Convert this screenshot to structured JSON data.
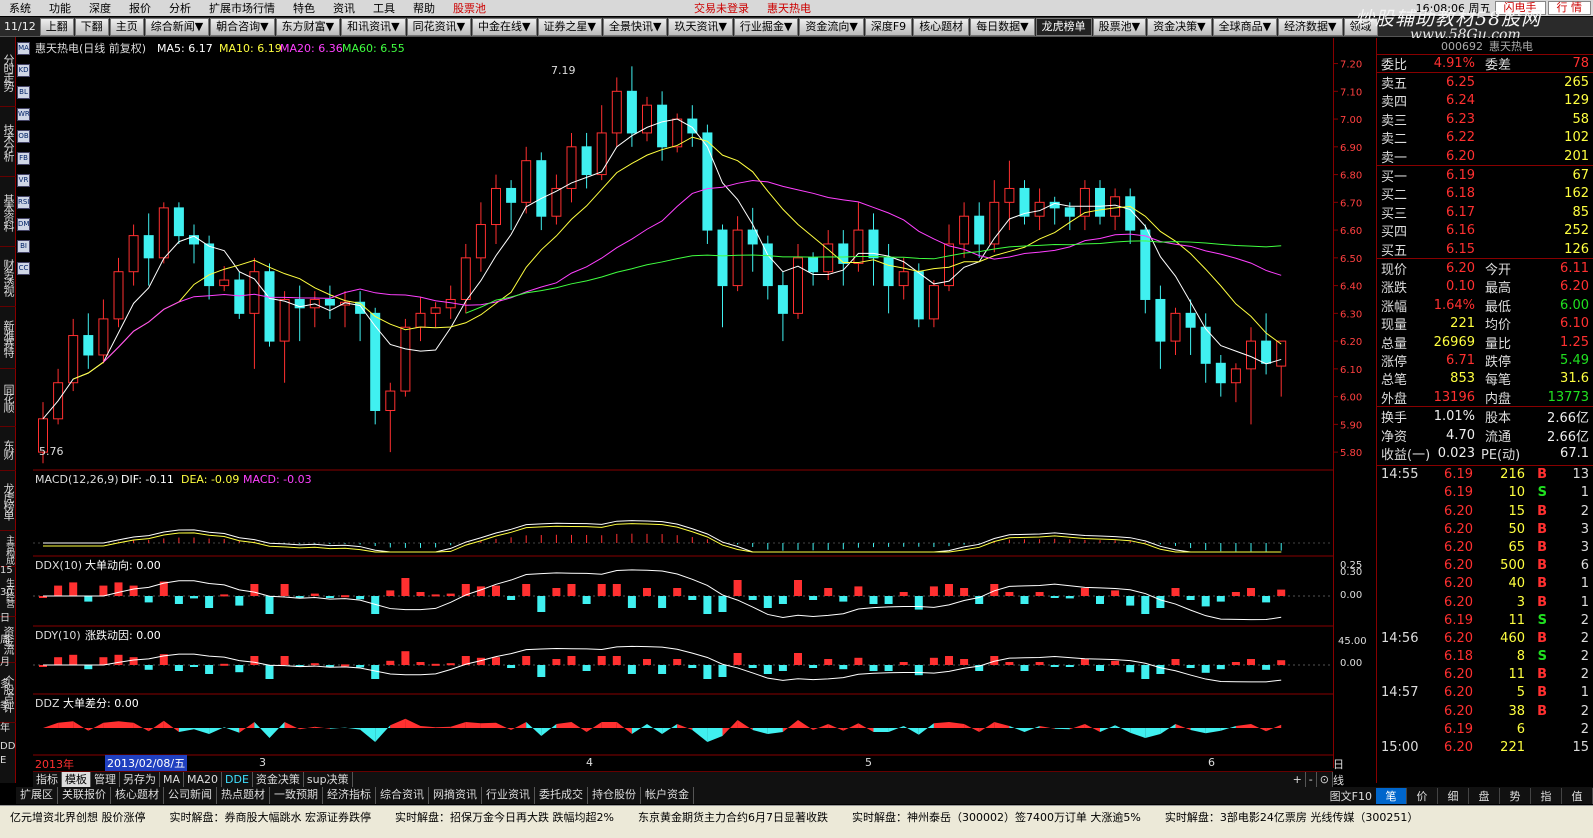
{
  "menubar": {
    "items": [
      "系统",
      "功能",
      "深度",
      "报价",
      "分析",
      "扩展市场行情",
      "特色",
      "资讯",
      "工具",
      "帮助"
    ],
    "stock_pool": "股票池",
    "login_status": "交易未登录",
    "stock_title": "惠天热电",
    "clock": "16:08:06 周五",
    "flash_button": "闪电手",
    "quote_button": "行 情"
  },
  "toolbar": {
    "page": "11/12",
    "buttons": [
      "上翻",
      "下翻",
      "主页",
      "综合新闻▼",
      "朝合咨询▼",
      "东方财富▼",
      "和讯资讯▼",
      "同花资讯▼",
      "中金在线▼",
      "证券之星▼",
      "全景快讯▼",
      "玖天资讯▼",
      "行业掘金▼",
      "资金流向▼",
      "深度F9",
      "核心题材",
      "每日数据▼",
      "龙虎榜单",
      "股票池▼",
      "资金决策▼",
      "全球商品▼",
      "经济数据▼",
      "领域"
    ]
  },
  "watermark": {
    "line1": "炒股辅助教材58股网",
    "line2": "www.58Gu.com"
  },
  "left_tabs": [
    "分时走势",
    "技术分析",
    "基本资料",
    "财务透视",
    "新雅赛特",
    "同花顺",
    "东财",
    "龙虎榜单",
    "主营构成",
    "生产经营",
    "资金流",
    "个股点评"
  ],
  "left_side_labels": [
    "15",
    "30",
    "日",
    "周",
    "月",
    "多",
    "季",
    "年",
    "DD",
    "E"
  ],
  "icons": [
    "ma-icon",
    "kdj-icon",
    "boll-icon",
    "wr-icon",
    "obv-icon",
    "fib-icon",
    "vr-icon",
    "rsi-icon",
    "dmi-icon",
    "bias-icon",
    "cci-icon"
  ],
  "icon_labels": [
    "MA",
    "KD",
    "BL",
    "WR",
    "OB",
    "FB",
    "VR",
    "RSI",
    "DM",
    "BI",
    "CC"
  ],
  "main_chart": {
    "title": "惠天热电(日线 前复权)",
    "ma5_label": "MA5: 6.17",
    "ma10_label": "MA10: 6.19",
    "ma20_label": "MA20: 6.36",
    "ma60_label": "MA60: 6.55",
    "high_marker": "7.19",
    "low_marker": "5.76",
    "price_scale": [
      "7.20",
      "7.10",
      "7.00",
      "6.90",
      "6.80",
      "6.70",
      "6.60",
      "6.50",
      "6.40",
      "6.30",
      "6.20",
      "6.10",
      "6.00",
      "5.90",
      "5.80"
    ],
    "colors": {
      "up": "#ff3030",
      "down": "#40f0f0",
      "ma5": "#ffffff",
      "ma10": "#ffff40",
      "ma20": "#ff40ff",
      "ma60": "#40ff40"
    }
  },
  "macd": {
    "title": "MACD(12,26,9)",
    "dif": "DIF: -0.11",
    "dea": "DEA: -0.09",
    "macd": "MACD: -0.03",
    "scale": [
      "0.25"
    ]
  },
  "ddx": {
    "title": "DDX(10)",
    "name": "大单动向: 0.00",
    "scale": [
      "0.30",
      "0.00"
    ]
  },
  "ddy": {
    "title": "DDY(10)",
    "name": "涨跌动因: 0.00",
    "scale": [
      "45.00",
      "0.00"
    ]
  },
  "ddz": {
    "title": "DDZ",
    "name": "大单差分: 0.00"
  },
  "datebar": {
    "year": "2013年",
    "cursor_date": "2013/02/08/五",
    "months": [
      "3",
      "4",
      "5",
      "6"
    ],
    "period": "日线"
  },
  "bottom_tabs1": [
    "指标",
    "模板",
    "管理",
    "另存为",
    "MA",
    "MA20",
    "DDE",
    "资金决策",
    "sup决策"
  ],
  "bottom_tabs2": [
    "扩展区",
    "关联报价",
    "核心题材",
    "公司新闻",
    "热点题材",
    "一致预期",
    "经济指标",
    "综合资讯",
    "网摘资讯",
    "行业资讯",
    "委托成交",
    "持仓股份",
    "帐户资金"
  ],
  "bottom_tabs2_right": "图文F10",
  "zoom_buttons": [
    "+",
    "-",
    "⊙"
  ],
  "right_tabs": [
    "笔",
    "价",
    "细",
    "盘",
    "势",
    "指",
    "值"
  ],
  "quote": {
    "code": "000692",
    "name": "惠天热电",
    "webi": {
      "label": "委比",
      "value": "4.91%",
      "label2": "委差",
      "value2": "78"
    },
    "sell": [
      {
        "label": "卖五",
        "price": "6.25",
        "vol": "265"
      },
      {
        "label": "卖四",
        "price": "6.24",
        "vol": "129"
      },
      {
        "label": "卖三",
        "price": "6.23",
        "vol": "58"
      },
      {
        "label": "卖二",
        "price": "6.22",
        "vol": "102"
      },
      {
        "label": "卖一",
        "price": "6.20",
        "vol": "201"
      }
    ],
    "buy": [
      {
        "label": "买一",
        "price": "6.19",
        "vol": "67"
      },
      {
        "label": "买二",
        "price": "6.18",
        "vol": "162"
      },
      {
        "label": "买三",
        "price": "6.17",
        "vol": "85"
      },
      {
        "label": "买四",
        "price": "6.16",
        "vol": "252"
      },
      {
        "label": "买五",
        "price": "6.15",
        "vol": "126"
      }
    ],
    "stats": [
      {
        "l1": "现价",
        "v1": "6.20",
        "l2": "今开",
        "v2": "6.11"
      },
      {
        "l1": "涨跌",
        "v1": "0.10",
        "l2": "最高",
        "v2": "6.20"
      },
      {
        "l1": "涨幅",
        "v1": "1.64%",
        "l2": "最低",
        "v2": "6.00"
      },
      {
        "l1": "现量",
        "v1": "221",
        "l2": "均价",
        "v2": "6.10"
      },
      {
        "l1": "总量",
        "v1": "26969",
        "l2": "量比",
        "v2": "1.25"
      },
      {
        "l1": "涨停",
        "v1": "6.71",
        "l2": "跌停",
        "v2": "5.49"
      },
      {
        "l1": "总笔",
        "v1": "853",
        "l2": "每笔",
        "v2": "31.6"
      },
      {
        "l1": "外盘",
        "v1": "13196",
        "l2": "内盘",
        "v2": "13773"
      }
    ],
    "extra": [
      {
        "l1": "换手",
        "v1": "1.01%",
        "l2": "股本",
        "v2": "2.66亿"
      },
      {
        "l1": "净资",
        "v1": "4.70",
        "l2": "流通",
        "v2": "2.66亿"
      },
      {
        "l1": "收益(一)",
        "v1": "0.023",
        "l2": "PE(动)",
        "v2": "67.1"
      }
    ]
  },
  "ticks": [
    {
      "t": "14:55",
      "p": "6.19",
      "v": "216",
      "bs": "B",
      "n": "13"
    },
    {
      "t": "",
      "p": "6.19",
      "v": "10",
      "bs": "S",
      "n": "1"
    },
    {
      "t": "",
      "p": "6.20",
      "v": "15",
      "bs": "B",
      "n": "2"
    },
    {
      "t": "",
      "p": "6.20",
      "v": "50",
      "bs": "B",
      "n": "3"
    },
    {
      "t": "",
      "p": "6.20",
      "v": "65",
      "bs": "B",
      "n": "3"
    },
    {
      "t": "",
      "p": "6.20",
      "v": "500",
      "bs": "B",
      "n": "6"
    },
    {
      "t": "",
      "p": "6.20",
      "v": "40",
      "bs": "B",
      "n": "1"
    },
    {
      "t": "",
      "p": "6.20",
      "v": "3",
      "bs": "B",
      "n": "1"
    },
    {
      "t": "",
      "p": "6.19",
      "v": "11",
      "bs": "S",
      "n": "2"
    },
    {
      "t": "14:56",
      "p": "6.20",
      "v": "460",
      "bs": "B",
      "n": "2"
    },
    {
      "t": "",
      "p": "6.18",
      "v": "8",
      "bs": "S",
      "n": "2"
    },
    {
      "t": "",
      "p": "6.20",
      "v": "11",
      "bs": "B",
      "n": "2"
    },
    {
      "t": "14:57",
      "p": "6.20",
      "v": "5",
      "bs": "B",
      "n": "1"
    },
    {
      "t": "",
      "p": "6.20",
      "v": "38",
      "bs": "B",
      "n": "2"
    },
    {
      "t": "",
      "p": "6.19",
      "v": "6",
      "bs": "",
      "n": "2"
    },
    {
      "t": "15:00",
      "p": "6.20",
      "v": "221",
      "bs": "",
      "n": "15"
    }
  ],
  "statusbar": {
    "items": [
      "亿元增资北界创想 股价涨停",
      "实时解盘：券商股大幅跳水 宏源证券跌停",
      "实时解盘：招保万金今日再大跌 跌幅均超2%",
      "东京黄金期货主力合约6月7日显著收跌",
      "实时解盘：神州泰岳（300002）签7400万订单 大涨逾5%",
      "实时解盘：3部电影24亿票房 光线传媒（300251）"
    ]
  },
  "chart_data": {
    "type": "candlestick",
    "title": "惠天热电(日线 前复权)",
    "ylim": [
      5.75,
      7.22
    ],
    "candles": [
      [
        5.8,
        5.92,
        5.76,
        5.98
      ],
      [
        5.92,
        6.05,
        5.9,
        6.1
      ],
      [
        6.05,
        6.22,
        6.02,
        6.28
      ],
      [
        6.22,
        6.15,
        6.1,
        6.3
      ],
      [
        6.15,
        6.28,
        6.12,
        6.35
      ],
      [
        6.28,
        6.45,
        6.25,
        6.5
      ],
      [
        6.45,
        6.58,
        6.4,
        6.62
      ],
      [
        6.58,
        6.5,
        6.4,
        6.66
      ],
      [
        6.5,
        6.68,
        6.48,
        6.7
      ],
      [
        6.68,
        6.58,
        6.55,
        6.7
      ],
      [
        6.58,
        6.55,
        6.48,
        6.62
      ],
      [
        6.55,
        6.4,
        6.35,
        6.58
      ],
      [
        6.4,
        6.42,
        6.38,
        6.47
      ],
      [
        6.42,
        6.3,
        6.28,
        6.45
      ],
      [
        6.3,
        6.45,
        6.1,
        6.5
      ],
      [
        6.45,
        6.2,
        6.18,
        6.48
      ],
      [
        6.2,
        6.35,
        6.05,
        6.38
      ],
      [
        6.35,
        6.32,
        6.2,
        6.4
      ],
      [
        6.32,
        6.35,
        6.25,
        6.38
      ],
      [
        6.35,
        6.33,
        6.28,
        6.4
      ],
      [
        6.33,
        6.34,
        6.25,
        6.38
      ],
      [
        6.34,
        6.3,
        6.2,
        6.38
      ],
      [
        6.3,
        5.95,
        5.9,
        6.32
      ],
      [
        5.95,
        6.02,
        5.8,
        6.05
      ],
      [
        6.02,
        6.25,
        6.0,
        6.28
      ],
      [
        6.25,
        6.3,
        6.2,
        6.36
      ],
      [
        6.3,
        6.32,
        6.25,
        6.34
      ],
      [
        6.32,
        6.35,
        6.28,
        6.4
      ],
      [
        6.35,
        6.5,
        6.3,
        6.55
      ],
      [
        6.5,
        6.62,
        6.45,
        6.7
      ],
      [
        6.62,
        6.75,
        6.55,
        6.8
      ],
      [
        6.75,
        6.7,
        6.6,
        6.78
      ],
      [
        6.7,
        6.85,
        6.66,
        6.9
      ],
      [
        6.85,
        6.65,
        6.6,
        6.88
      ],
      [
        6.65,
        6.75,
        6.62,
        6.8
      ],
      [
        6.75,
        6.9,
        6.7,
        6.95
      ],
      [
        6.9,
        6.8,
        6.75,
        6.95
      ],
      [
        6.8,
        6.95,
        6.78,
        7.05
      ],
      [
        6.95,
        7.1,
        6.9,
        7.15
      ],
      [
        7.1,
        6.95,
        6.9,
        7.19
      ],
      [
        6.95,
        7.05,
        6.92,
        7.08
      ],
      [
        7.05,
        6.9,
        6.85,
        7.1
      ],
      [
        6.9,
        7.0,
        6.88,
        7.02
      ],
      [
        7.0,
        6.95,
        6.9,
        7.05
      ],
      [
        6.95,
        6.6,
        6.55,
        6.98
      ],
      [
        6.6,
        6.4,
        6.25,
        6.62
      ],
      [
        6.4,
        6.6,
        6.38,
        6.65
      ],
      [
        6.6,
        6.55,
        6.45,
        6.68
      ],
      [
        6.55,
        6.4,
        6.35,
        6.58
      ],
      [
        6.4,
        6.3,
        6.2,
        6.45
      ],
      [
        6.3,
        6.5,
        6.28,
        6.55
      ],
      [
        6.5,
        6.45,
        6.4,
        6.52
      ],
      [
        6.45,
        6.55,
        6.42,
        6.6
      ],
      [
        6.55,
        6.48,
        6.4,
        6.6
      ],
      [
        6.48,
        6.6,
        6.45,
        6.7
      ],
      [
        6.6,
        6.5,
        6.4,
        6.66
      ],
      [
        6.5,
        6.4,
        6.3,
        6.55
      ],
      [
        6.4,
        6.45,
        6.35,
        6.5
      ],
      [
        6.45,
        6.28,
        6.25,
        6.48
      ],
      [
        6.28,
        6.4,
        6.25,
        6.42
      ],
      [
        6.4,
        6.55,
        6.38,
        6.62
      ],
      [
        6.55,
        6.65,
        6.5,
        6.7
      ],
      [
        6.65,
        6.55,
        6.5,
        6.7
      ],
      [
        6.55,
        6.7,
        6.52,
        6.78
      ],
      [
        6.7,
        6.75,
        6.6,
        6.85
      ],
      [
        6.75,
        6.65,
        6.62,
        6.78
      ],
      [
        6.65,
        6.7,
        6.6,
        6.75
      ],
      [
        6.7,
        6.68,
        6.62,
        6.72
      ],
      [
        6.68,
        6.65,
        6.6,
        6.7
      ],
      [
        6.65,
        6.75,
        6.6,
        6.78
      ],
      [
        6.75,
        6.65,
        6.62,
        6.78
      ],
      [
        6.65,
        6.72,
        6.6,
        6.75
      ],
      [
        6.72,
        6.6,
        6.55,
        6.75
      ],
      [
        6.6,
        6.35,
        6.3,
        6.62
      ],
      [
        6.35,
        6.2,
        6.1,
        6.4
      ],
      [
        6.2,
        6.3,
        6.15,
        6.32
      ],
      [
        6.3,
        6.25,
        6.15,
        6.35
      ],
      [
        6.25,
        6.12,
        6.05,
        6.3
      ],
      [
        6.12,
        6.05,
        6.0,
        6.15
      ],
      [
        6.05,
        6.1,
        5.98,
        6.12
      ],
      [
        6.1,
        6.2,
        5.9,
        6.25
      ],
      [
        6.2,
        6.12,
        6.08,
        6.3
      ],
      [
        6.11,
        6.2,
        6.0,
        6.2
      ]
    ]
  }
}
